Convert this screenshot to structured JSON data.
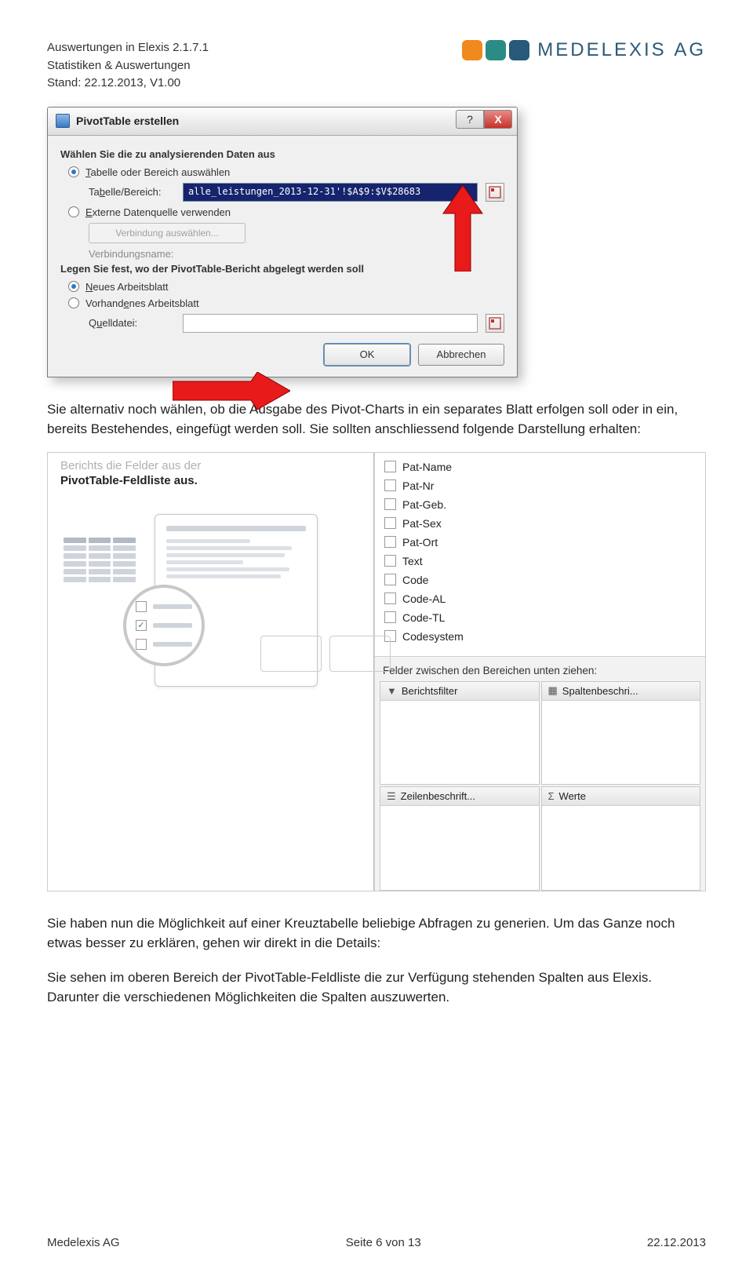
{
  "header": {
    "line1": "Auswertungen in Elexis 2.1.7.1",
    "line2": "Statistiken & Auswertungen",
    "line3": "Stand: 22.12.2013, V1.00",
    "brand_name": "MEDELEXIS",
    "brand_suffix": "AG"
  },
  "dialog": {
    "title": "PivotTable erstellen",
    "help_symbol": "?",
    "close_symbol": "X",
    "section1": "Wählen Sie die zu analysierenden Daten aus",
    "opt_table": "Tabelle oder Bereich auswählen",
    "label_range": "Tabelle/Bereich:",
    "range_value": "alle_leistungen_2013-12-31'!$A$9:$V$28683",
    "opt_external": "Externe Datenquelle verwenden",
    "btn_connect": "Verbindung auswählen...",
    "conn_name": "Verbindungsname:",
    "section2": "Legen Sie fest, wo der PivotTable-Bericht abgelegt werden soll",
    "opt_new": "Neues Arbeitsblatt",
    "opt_existing": "Vorhandenes Arbeitsblatt",
    "label_source": "Quelldatei:",
    "ok": "OK",
    "cancel": "Abbrechen"
  },
  "para1": "Sie alternativ noch wählen, ob die Ausgabe des Pivot-Charts in ein separates Blatt erfolgen soll oder in ein, bereits Bestehendes, eingefügt werden soll. Sie sollten anschliessend folgende Darstellung erhalten:",
  "shot2": {
    "gray_line": "Berichts die Felder aus der",
    "bold_line": "PivotTable-Feldliste aus.",
    "fields": [
      "Pat-Name",
      "Pat-Nr",
      "Pat-Geb.",
      "Pat-Sex",
      "Pat-Ort",
      "Text",
      "Code",
      "Code-AL",
      "Code-TL",
      "Codesystem"
    ],
    "drag_note": "Felder zwischen den Bereichen unten ziehen:",
    "zone1": "Berichtsfilter",
    "zone2": "Spaltenbeschri...",
    "zone3": "Zeilenbeschrift...",
    "zone4": "Werte"
  },
  "para2": "Sie haben nun die Möglichkeit auf einer Kreuztabelle beliebige Abfragen zu generien. Um das Ganze noch etwas besser zu erklären, gehen wir direkt in die Details:",
  "para3": "Sie sehen im oberen Bereich der PivotTable-Feldliste die zur Verfügung stehenden Spalten aus Elexis. Darunter die verschiedenen Möglichkeiten die Spalten auszuwerten.",
  "footer": {
    "left": "Medelexis AG",
    "center": "Seite 6 von 13",
    "right": "22.12.2013"
  }
}
